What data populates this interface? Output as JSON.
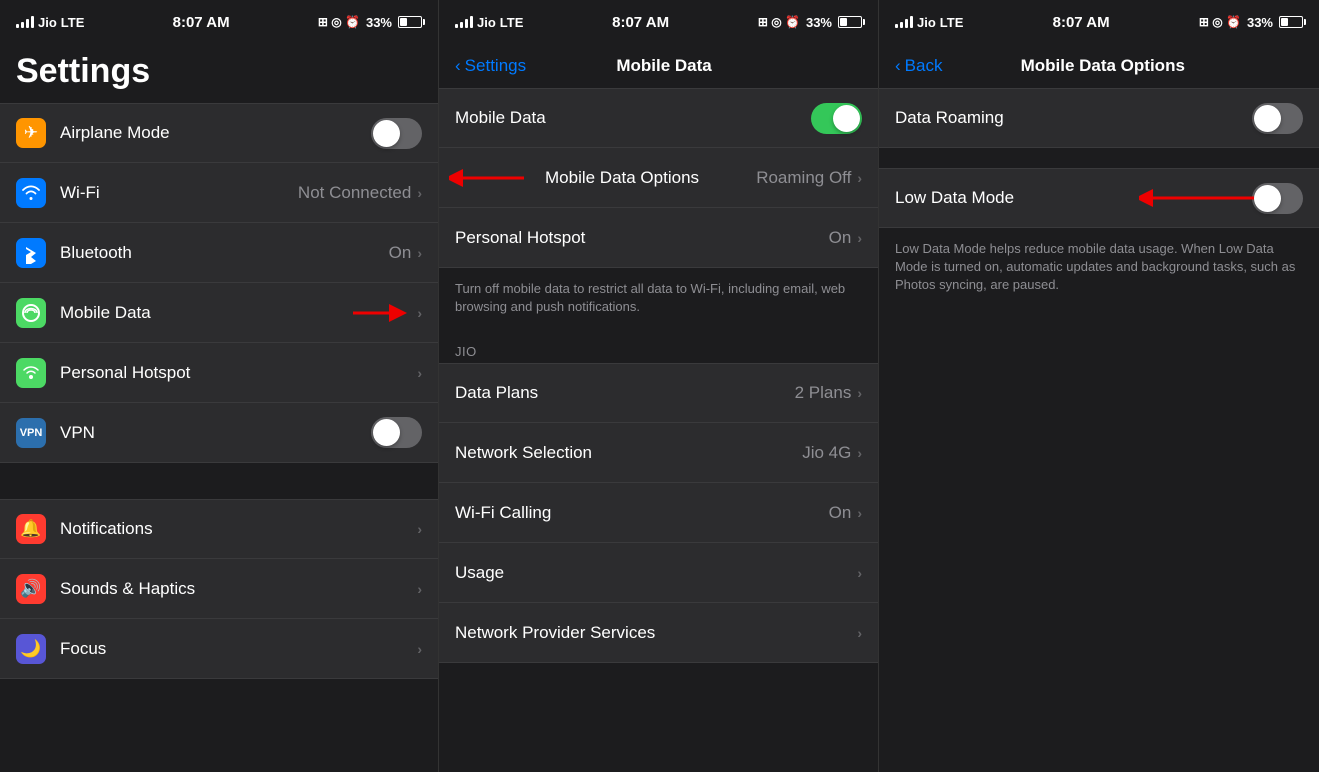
{
  "panels": {
    "left": {
      "statusBar": {
        "carrier": "Jio",
        "networkType": "LTE",
        "time": "8:07 AM",
        "batteryPercent": "33%"
      },
      "title": "Settings",
      "groups": [
        {
          "items": [
            {
              "id": "airplane-mode",
              "label": "Airplane Mode",
              "icon": "✈",
              "iconBg": "#ff9500",
              "type": "toggle",
              "toggleOn": false
            },
            {
              "id": "wifi",
              "label": "Wi-Fi",
              "icon": "📶",
              "iconBg": "#007aff",
              "type": "nav",
              "value": "Not Connected"
            },
            {
              "id": "bluetooth",
              "label": "Bluetooth",
              "icon": "✱",
              "iconBg": "#007aff",
              "type": "nav",
              "value": "On"
            },
            {
              "id": "mobile-data",
              "label": "Mobile Data",
              "icon": "((•))",
              "iconBg": "#4cd964",
              "type": "nav",
              "value": ""
            },
            {
              "id": "personal-hotspot",
              "label": "Personal Hotspot",
              "icon": "⊕",
              "iconBg": "#4cd964",
              "type": "nav",
              "value": ""
            },
            {
              "id": "vpn",
              "label": "VPN",
              "icon": "VPN",
              "iconBg": "#2c6fad",
              "type": "toggle",
              "toggleOn": false
            }
          ]
        },
        {
          "items": [
            {
              "id": "notifications",
              "label": "Notifications",
              "icon": "🔔",
              "iconBg": "#ff3b30",
              "type": "nav",
              "value": ""
            },
            {
              "id": "sounds",
              "label": "Sounds & Haptics",
              "icon": "🔊",
              "iconBg": "#ff3b30",
              "type": "nav",
              "value": ""
            },
            {
              "id": "focus",
              "label": "Focus",
              "icon": "🌙",
              "iconBg": "#5856d6",
              "type": "nav",
              "value": ""
            }
          ]
        }
      ]
    },
    "middle": {
      "statusBar": {
        "carrier": "Jio",
        "networkType": "LTE",
        "time": "8:07 AM",
        "batteryPercent": "33%"
      },
      "navBack": "Settings",
      "navTitle": "Mobile Data",
      "items": [
        {
          "id": "mobile-data-toggle",
          "label": "Mobile Data",
          "type": "toggle",
          "toggleOn": true
        },
        {
          "id": "mobile-data-options",
          "label": "Mobile Data Options",
          "type": "nav",
          "value": "Roaming Off"
        },
        {
          "id": "personal-hotspot",
          "label": "Personal Hotspot",
          "type": "nav",
          "value": "On"
        }
      ],
      "description": "Turn off mobile data to restrict all data to Wi-Fi, including email, web browsing and push notifications.",
      "jioSection": "JIO",
      "jioItems": [
        {
          "id": "data-plans",
          "label": "Data Plans",
          "type": "nav",
          "value": "2 Plans"
        },
        {
          "id": "network-selection",
          "label": "Network Selection",
          "type": "nav",
          "value": "Jio 4G"
        },
        {
          "id": "wifi-calling",
          "label": "Wi-Fi Calling",
          "type": "nav",
          "value": "On"
        },
        {
          "id": "usage",
          "label": "Usage",
          "type": "nav",
          "value": ""
        },
        {
          "id": "network-provider",
          "label": "Network Provider Services",
          "type": "nav",
          "value": ""
        }
      ]
    },
    "right": {
      "statusBar": {
        "carrier": "Jio",
        "networkType": "LTE",
        "time": "8:07 AM",
        "batteryPercent": "33%"
      },
      "navBack": "Back",
      "navTitle": "Mobile Data Options",
      "items": [
        {
          "id": "data-roaming",
          "label": "Data Roaming",
          "type": "toggle",
          "toggleOn": false
        },
        {
          "id": "low-data-mode",
          "label": "Low Data Mode",
          "type": "toggle",
          "toggleOn": false
        }
      ],
      "description": "Low Data Mode helps reduce mobile data usage. When Low Data Mode is turned on, automatic updates and background tasks, such as Photos syncing, are paused."
    }
  },
  "arrows": {
    "panel1_arrow": "Mobile Data row arrow pointing right",
    "panel2_arrow": "Mobile Data Options row arrow pointing left",
    "panel3_arrow": "Low Data Mode arrow pointing left"
  }
}
